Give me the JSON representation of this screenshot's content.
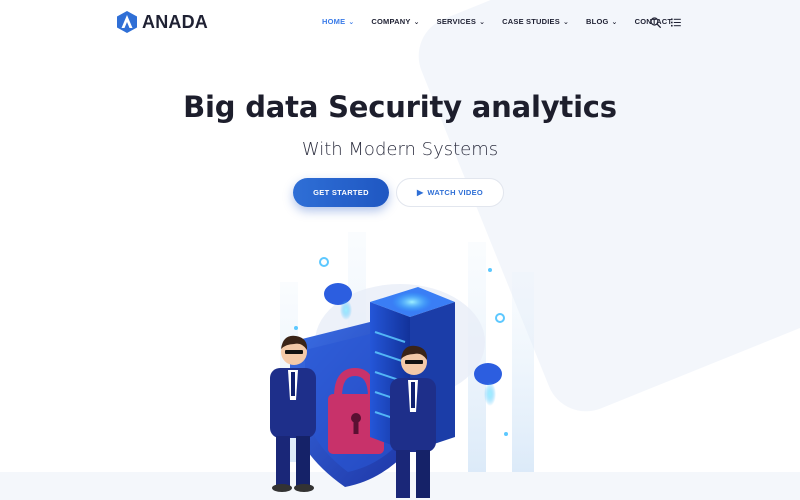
{
  "brand": {
    "name": "ANADA",
    "accent": "#2f6fd6"
  },
  "nav": {
    "items": [
      {
        "label": "HOME",
        "has_dropdown": true,
        "active": true
      },
      {
        "label": "COMPANY",
        "has_dropdown": true,
        "active": false
      },
      {
        "label": "SERVICES",
        "has_dropdown": true,
        "active": false
      },
      {
        "label": "CASE STUDIES",
        "has_dropdown": true,
        "active": false
      },
      {
        "label": "BLOG",
        "has_dropdown": true,
        "active": false
      },
      {
        "label": "CONTACT",
        "has_dropdown": false,
        "active": false
      }
    ],
    "chevron": "⌄",
    "icons": [
      "search-icon",
      "list-menu-icon"
    ]
  },
  "hero": {
    "title": "Big data Security analytics",
    "subtitle": "With Modern Systems",
    "primary_cta": "GET STARTED",
    "secondary_cta": "WATCH VIDEO",
    "secondary_icon": "▶"
  },
  "illustration": {
    "name": "security-guards-server-illustration"
  }
}
